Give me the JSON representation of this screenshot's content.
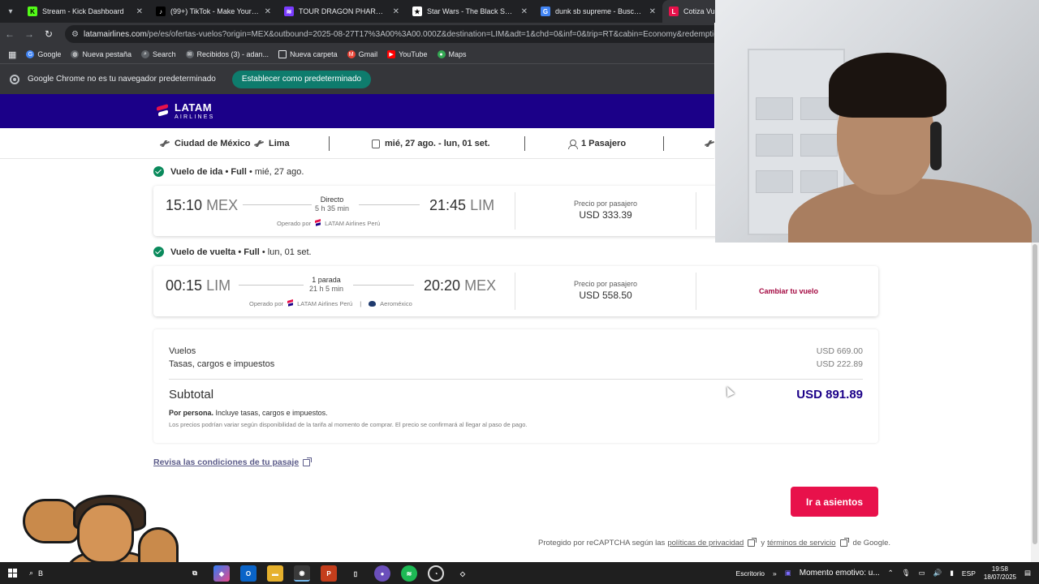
{
  "browser": {
    "tabs": [
      {
        "label": "Stream - Kick Dashboard",
        "color": "#53fc18",
        "glyph": "K"
      },
      {
        "label": "(99+) TikTok - Make Your Day",
        "color": "#000000",
        "glyph": "♪"
      },
      {
        "label": "TOUR DRAGON PHARMA | Join",
        "color": "#7a3cff",
        "glyph": "≋"
      },
      {
        "label": "Star Wars - The Black Series - C",
        "color": "#ffffff",
        "glyph": "★"
      },
      {
        "label": "dunk sb supreme - Buscar con",
        "color": "#4285f4",
        "glyph": "G"
      },
      {
        "label": "Cotiza Vuel",
        "color": "#e8114b",
        "glyph": "L"
      }
    ],
    "url_host": "latamairlines.com",
    "url_path": "/pe/es/ofertas-vuelos?origin=MEX&outbound=2025-08-27T17%3A00%3A00.000Z&destination=LIM&adt=1&chd=0&inf=0&trip=RT&cabin=Economy&redemption=false&",
    "bookmarks": [
      {
        "label": "Google",
        "color": "#4285f4"
      },
      {
        "label": "Nueva pestaña",
        "color": "#5f6368"
      },
      {
        "label": "Search",
        "color": "#5f6368"
      },
      {
        "label": "Recibidos (3) - adan...",
        "color": "#5f6368"
      },
      {
        "label": "Nueva carpeta",
        "color": "#5f6368"
      },
      {
        "label": "Gmail",
        "color": "#ea4335"
      },
      {
        "label": "YouTube",
        "color": "#ff0000"
      },
      {
        "label": "Maps",
        "color": "#34a853"
      }
    ],
    "infobar": {
      "message": "Google Chrome no es tu navegador predeterminado",
      "button": "Establecer como predeterminado"
    }
  },
  "latam": {
    "logo_main": "LATAM",
    "logo_sub": "AIRLINES",
    "search": {
      "origin": "Ciudad de México",
      "destination": "Lima",
      "dates": "mié, 27 ago. - lun, 01 set.",
      "passengers": "1 Pasajero"
    }
  },
  "outbound": {
    "title": "Vuelo de ida",
    "fare": "• Full",
    "date": "• mié, 27 ago.",
    "dep_time": "15:10",
    "dep_code": "MEX",
    "arr_time": "21:45",
    "arr_code": "LIM",
    "stops": "Directo",
    "duration": "5 h 35 min",
    "operated_label": "Operado por",
    "operator": "LATAM Airlines Perú",
    "price_label": "Precio por pasajero",
    "price": "USD 333.39"
  },
  "return": {
    "title": "Vuelo de vuelta",
    "fare": "• Full",
    "date": "• lun, 01 set.",
    "dep_time": "00:15",
    "dep_code": "LIM",
    "arr_time": "20:20",
    "arr_code": "MEX",
    "stops": "1 parada",
    "duration": "21 h 5 min",
    "operated_label": "Operado por",
    "operator": "LATAM Airlines Perú",
    "operator2": "Aeroméxico",
    "price_label": "Precio por pasajero",
    "price": "USD 558.50",
    "change_link": "Cambiar tu vuelo"
  },
  "summary": {
    "flights_label": "Vuelos",
    "flights_amount": "USD 669.00",
    "taxes_label": "Tasas, cargos e impuestos",
    "taxes_amount": "USD 222.89",
    "subtotal_label": "Subtotal",
    "subtotal_amount": "USD 891.89",
    "per_person_bold": "Por persona.",
    "per_person_text": "Incluye tasas, cargos e impuestos.",
    "disclaimer": "Los precios podrían variar según disponibilidad de la tarifa al momento de comprar. El precio se confirmará al llegar al paso de pago."
  },
  "conditions_link": "Revisa las condiciones de tu pasaje",
  "cta_button": "Ir a asientos",
  "recaptcha": {
    "prefix": "Protegido por reCAPTCHA según las",
    "privacy": "políticas de privacidad",
    "and": "y",
    "terms": "términos de servicio",
    "suffix": "de Google."
  },
  "taskbar": {
    "search_text": "B",
    "desktop_label": "Escritorio",
    "media_title": "Momento emotivo: u...",
    "lang": "ESP",
    "time": "19:58",
    "date": "18/07/2025"
  }
}
